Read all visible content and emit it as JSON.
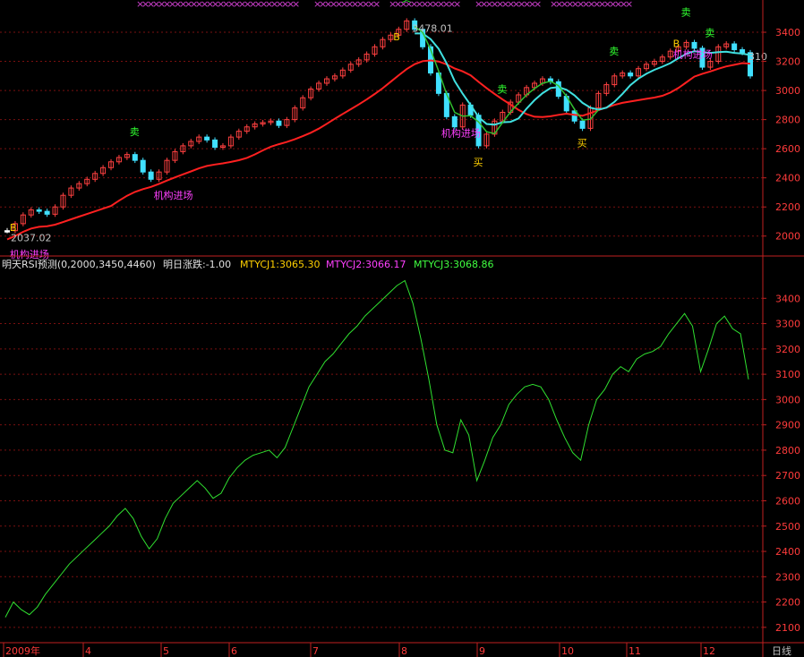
{
  "upper_panel": {
    "high_label": "3478.01",
    "low_label": "2037.02",
    "last_label": "310",
    "signals": {
      "buy": "B",
      "sell": "卖",
      "buy2": "买",
      "inst_entry": "机构进场"
    },
    "colors": {
      "up_candle": "#ff4040",
      "down_candle": "#40e0ff",
      "flat_candle": "#ffffff",
      "ma_long": "#ff2020",
      "ma_short": "#40e0e0",
      "ma_short2": "#30c030",
      "sell_sign": "#30ff30",
      "inst_entry": "#ff40ff",
      "buy_sign": "#ffd000"
    }
  },
  "indicator_header": {
    "name": "明天RSI预测(0,2000,3450,4460)",
    "tomorrow": "明日涨跌:-1.00",
    "mtycj1": "MTYCJ1:3065.30",
    "mtycj2": "MTYCJ2:3066.17",
    "mtycj3": "MTYCJ3:3068.86",
    "colors": {
      "name": "#e0e0e0",
      "mtycj1": "#ffd000",
      "mtycj2": "#ff40ff",
      "mtycj3": "#40ff40"
    }
  },
  "x_axis": {
    "labels": [
      "2009年",
      "4",
      "5",
      "6",
      "7",
      "8",
      "9",
      "10",
      "11",
      "12"
    ],
    "period": "日线"
  },
  "chart_data": [
    {
      "type": "line",
      "title": "",
      "ylim": [
        1900,
        3560
      ],
      "y_ticks": [
        2000,
        2200,
        2400,
        2600,
        2800,
        3000,
        3200,
        3400
      ],
      "series": [
        {
          "values": [
            2037,
            2085,
            2145,
            2180,
            2170,
            2150,
            2200,
            2280,
            2330,
            2360,
            2390,
            2430,
            2470,
            2510,
            2540,
            2560,
            2520,
            2440,
            2390,
            2440,
            2520,
            2580,
            2620,
            2650,
            2680,
            2660,
            2610,
            2620,
            2680,
            2720,
            2750,
            2770,
            2780,
            2790,
            2760,
            2800,
            2880,
            2950,
            3010,
            3050,
            3080,
            3100,
            3140,
            3180,
            3210,
            3250,
            3300,
            3350,
            3380,
            3420,
            3478,
            3420,
            3300,
            3120,
            2980,
            2820,
            2750,
            2900,
            2830,
            2620,
            2700,
            2790,
            2850,
            2920,
            2970,
            3020,
            3050,
            3080,
            3060,
            2960,
            2860,
            2790,
            2740,
            2880,
            2980,
            3040,
            3100,
            3120,
            3100,
            3150,
            3180,
            3200,
            3230,
            3270,
            3300,
            3330,
            3290,
            3160,
            3200,
            3300,
            3320,
            3280,
            3260,
            3100
          ]
        },
        {
          "name": "",
          "values": []
        }
      ]
    },
    {
      "type": "line",
      "title": "",
      "ylim": [
        2050,
        3500
      ],
      "y_ticks": [
        2100,
        2200,
        2300,
        2400,
        2500,
        2600,
        2700,
        2800,
        2900,
        3000,
        3100,
        3200,
        3300,
        3400
      ],
      "series": [
        {
          "values": [
            2140,
            2200,
            2170,
            2150,
            2180,
            2230,
            2270,
            2310,
            2350,
            2380,
            2410,
            2440,
            2470,
            2500,
            2540,
            2570,
            2530,
            2460,
            2410,
            2450,
            2530,
            2590,
            2620,
            2650,
            2680,
            2650,
            2610,
            2630,
            2690,
            2730,
            2760,
            2780,
            2790,
            2800,
            2770,
            2810,
            2890,
            2970,
            3050,
            3100,
            3150,
            3180,
            3220,
            3260,
            3290,
            3330,
            3360,
            3390,
            3420,
            3450,
            3470,
            3380,
            3240,
            3080,
            2900,
            2800,
            2790,
            2920,
            2860,
            2680,
            2760,
            2850,
            2900,
            2980,
            3020,
            3050,
            3060,
            3050,
            3000,
            2920,
            2850,
            2790,
            2760,
            2900,
            3000,
            3040,
            3100,
            3130,
            3110,
            3160,
            3180,
            3190,
            3210,
            3260,
            3300,
            3340,
            3290,
            3110,
            3200,
            3300,
            3330,
            3280,
            3260,
            3080
          ]
        }
      ]
    }
  ]
}
